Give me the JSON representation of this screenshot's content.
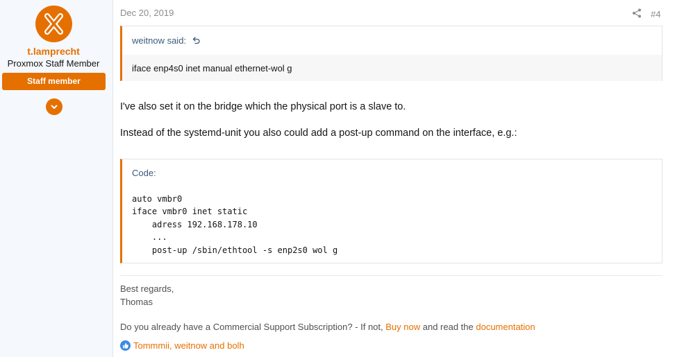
{
  "user": {
    "name": "t.lamprecht",
    "title": "Proxmox Staff Member",
    "badge": "Staff member",
    "avatar_icon": "proxmox-x-logo",
    "expand_icon": "chevron-down-icon"
  },
  "post": {
    "date": "Dec 20, 2019",
    "number": "#4",
    "share_icon": "share-icon",
    "quote": {
      "author": "weitnow said:",
      "arrow_icon": "quote-jump-icon",
      "text": "iface enp4s0 inet manual ethernet-wol g"
    },
    "paragraphs": [
      "I've also set it on the bridge which the physical port is a slave to.",
      "Instead of the systemd-unit you also could add a post-up command on the interface, e.g.:"
    ],
    "code": {
      "label": "Code:",
      "content": "auto vmbr0\niface vmbr0 inet static\n    adress 192.168.178.10\n    ...\n    post-up /sbin/ethtool -s enp2s0 wol g"
    },
    "signature": {
      "line1": "Best regards,",
      "line2": "Thomas",
      "line3_prefix": "Do you already have a Commercial Support Subscription? - If not, ",
      "line3_link1": "Buy now",
      "line3_middle": " and read the ",
      "line3_link2": "documentation"
    },
    "reactions": {
      "icon": "like-icon",
      "text": "Tommmii, weitnow and bolh"
    }
  },
  "colors": {
    "accent": "#e57000",
    "link_blue": "#3b5b7a",
    "like_blue": "#3b8ae6",
    "sidebar_bg": "#f5f8fc"
  }
}
